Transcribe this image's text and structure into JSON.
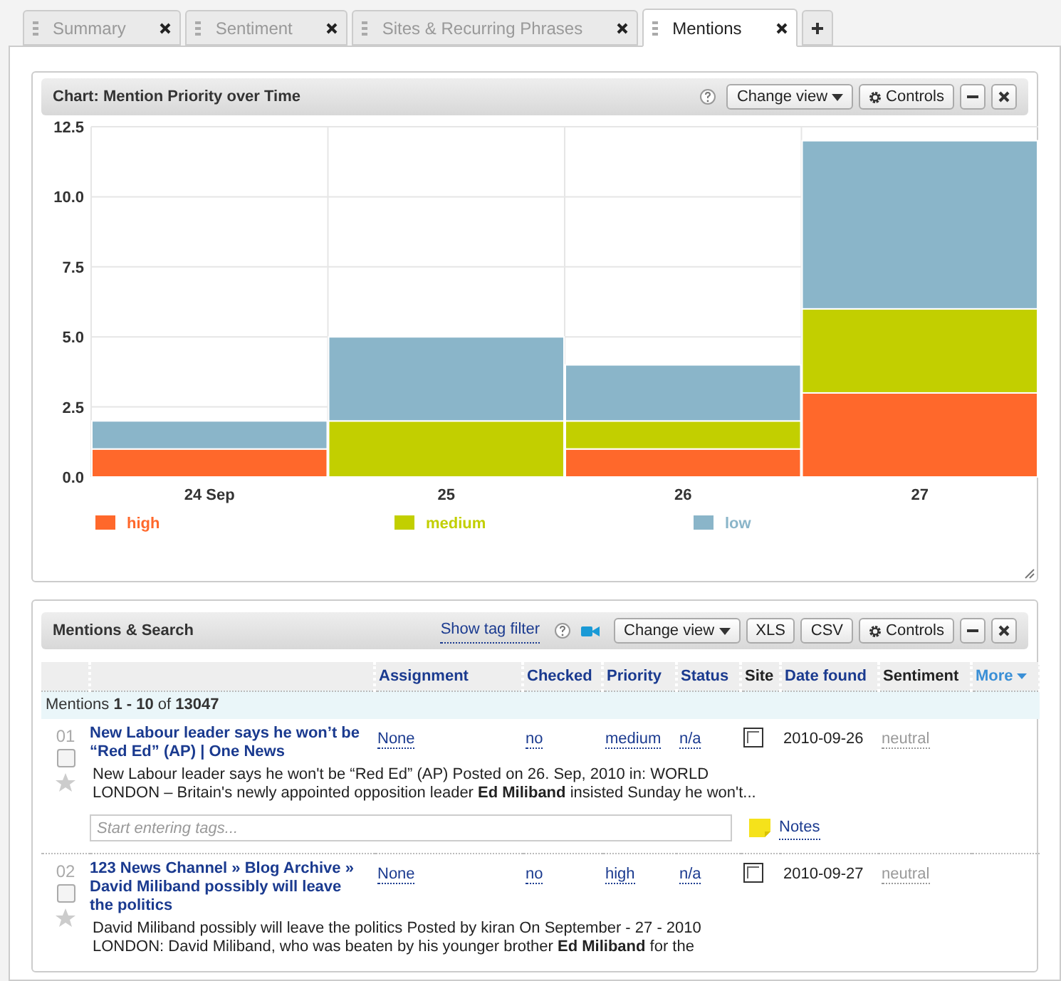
{
  "tabs": [
    {
      "label": "Summary",
      "selected": false
    },
    {
      "label": "Sentiment",
      "selected": false
    },
    {
      "label": "Sites & Recurring Phrases",
      "selected": false
    },
    {
      "label": "Mentions",
      "selected": true
    }
  ],
  "chart_widget": {
    "title": "Chart: Mention Priority over Time",
    "buttons": [
      "Change view",
      "Controls"
    ],
    "chart_data": {
      "type": "bar",
      "stacked": true,
      "categories": [
        "24 Sep",
        "25",
        "26",
        "27"
      ],
      "series": [
        {
          "name": "high",
          "color": "#ff682b",
          "values": [
            1,
            0,
            1,
            3
          ]
        },
        {
          "name": "medium",
          "color": "#c2cf00",
          "values": [
            0,
            2,
            1,
            3
          ]
        },
        {
          "name": "low",
          "color": "#8ab5c9",
          "values": [
            1,
            3,
            2,
            6
          ]
        }
      ],
      "ylim": [
        0,
        12.5
      ],
      "grid": true,
      "legend": true,
      "yticks": [
        {
          "value": 0,
          "label": "0.0"
        },
        {
          "value": 2.5,
          "label": "2.5"
        },
        {
          "value": 5,
          "label": "5.0"
        },
        {
          "value": 7.5,
          "label": "7.5"
        },
        {
          "value": 10,
          "label": "10.0"
        },
        {
          "value": 12.5,
          "label": "12.5"
        }
      ]
    }
  },
  "mentions_widget": {
    "title": "Mentions & Search",
    "tag_filter_link": "Show tag filter",
    "buttons": [
      "Change view",
      "XLS",
      "CSV",
      "Controls"
    ],
    "columns": [
      "Assignment",
      "Checked",
      "Priority",
      "Status",
      "Site",
      "Date found",
      "Sentiment",
      "More"
    ],
    "summary": "Mentions **1 - 10** of **13047**",
    "tags_placeholder": "Start entering tags...",
    "notes_link": "Notes",
    "rows": [
      {
        "number": "01",
        "selected": false,
        "starred": false,
        "title": "New Labour leader says he won’t be “Red Ed” (AP) | One News",
        "assignment": "None",
        "checked": "no",
        "priority": "medium",
        "status": "n/a",
        "date_found": "2010-09-26",
        "sentiment": "neutral",
        "snippet": "New Labour leader says he won't be “Red Ed” (AP) Posted on 26. Sep, 2010 in: WORLD LONDON – Britain's newly appointed opposition leader **Ed Miliband** insisted Sunday he won't..."
      },
      {
        "number": "02",
        "selected": false,
        "starred": false,
        "title": "123 News Channel » Blog Archive » David Miliband possibly will leave the politics",
        "assignment": "None",
        "checked": "no",
        "priority": "high",
        "status": "n/a",
        "date_found": "2010-09-27",
        "sentiment": "neutral",
        "snippet": "David Miliband possibly will leave the politics Posted by kiran On September - 27 - 2010 LONDON: David Miliband, who was beaten by his younger brother **Ed Miliband** for the"
      }
    ]
  }
}
